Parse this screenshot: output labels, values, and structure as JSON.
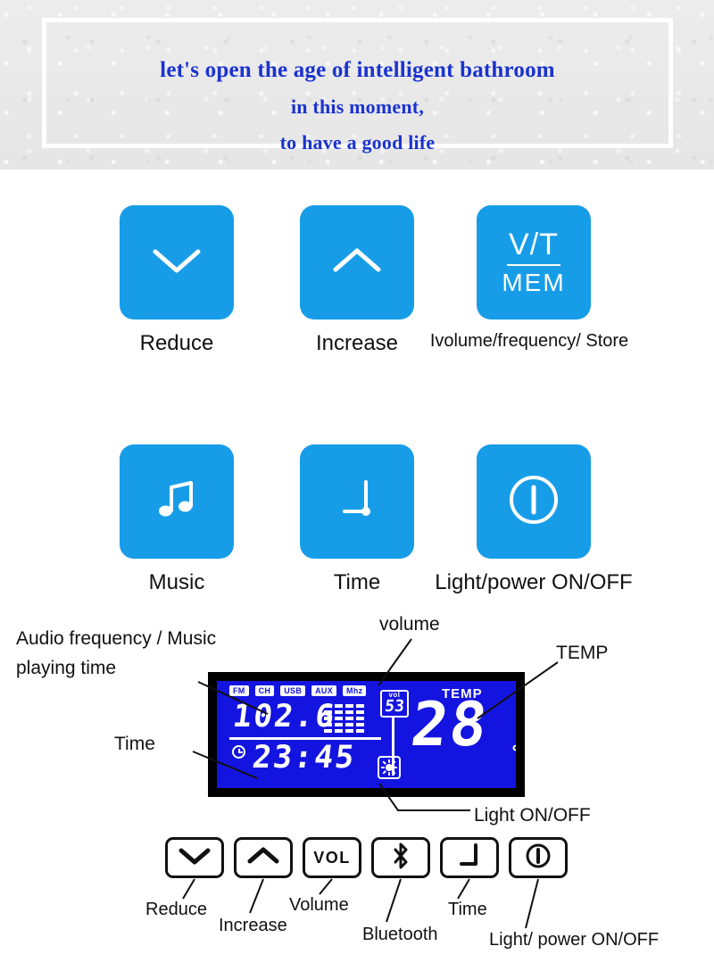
{
  "banner": {
    "line1": "let's open the age of intelligent bathroom",
    "line2": "in this moment,",
    "line3": "to have a good life",
    "text_color": "#1b33cf",
    "background_color": "#e9e9e9"
  },
  "buttons": {
    "accent_color": "#179de8",
    "items": [
      {
        "label": "Reduce",
        "icon": "chevron-down-icon"
      },
      {
        "label": "Increase",
        "icon": "chevron-up-icon"
      },
      {
        "label": "Ivolume/frequency/ Store",
        "icon": "vt-mem-icon",
        "glyph_top": "V/T",
        "glyph_bottom": "MEM"
      },
      {
        "label": "Music",
        "icon": "music-note-icon"
      },
      {
        "label": "Time",
        "icon": "clock-hands-icon"
      },
      {
        "label": "Light/power ON/OFF",
        "icon": "power-icon"
      }
    ]
  },
  "lcd": {
    "background_color": "#1414e0",
    "tags": [
      "FM",
      "CH",
      "USB",
      "AUX",
      "Mhz"
    ],
    "frequency": "102.6",
    "volume_caption": "vol",
    "volume_value": "53",
    "time": "23:45",
    "temp_caption": "TEMP",
    "temp_value": "28",
    "temp_unit": "℃",
    "signal_bars_columns": 4,
    "signal_bars_rows": 5
  },
  "callouts": {
    "audio": "Audio frequency / Music playing time",
    "time": "Time",
    "volume": "volume",
    "temp": "TEMP",
    "light": "Light ON/OFF"
  },
  "keys": {
    "items": [
      {
        "label": "Reduce",
        "icon": "chevron-down-icon"
      },
      {
        "label": "Increase",
        "icon": "chevron-up-icon"
      },
      {
        "label": "Volume",
        "icon": "vol-text-icon",
        "glyph": "VOL"
      },
      {
        "label": "Bluetooth",
        "icon": "bluetooth-icon"
      },
      {
        "label": "Time",
        "icon": "clock-hands-icon"
      },
      {
        "label": "Light/ power ON/OFF",
        "icon": "power-icon"
      }
    ]
  }
}
